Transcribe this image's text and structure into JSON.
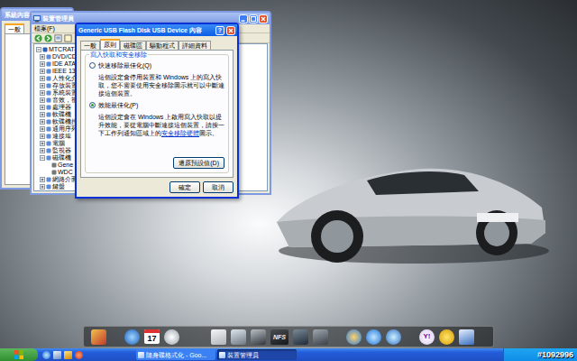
{
  "system_properties": {
    "title": "系統內容",
    "tabs": [
      {
        "label": "一般",
        "selected": true
      }
    ]
  },
  "device_manager": {
    "title": "裝置管理員",
    "menu": [
      "檔案(F)"
    ],
    "tree": [
      {
        "label": "MTCRAT-B8",
        "kind": "root",
        "expanded": true
      },
      {
        "label": "DVD/CD-",
        "kind": "category",
        "expanded": false
      },
      {
        "label": "IDE ATA",
        "kind": "category",
        "expanded": false
      },
      {
        "label": "IEEE 13",
        "kind": "category",
        "expanded": false
      },
      {
        "label": "人性化介",
        "kind": "category",
        "expanded": false
      },
      {
        "label": "存放裝置",
        "kind": "category",
        "expanded": false
      },
      {
        "label": "系統裝置",
        "kind": "category",
        "expanded": false
      },
      {
        "label": "音效，視",
        "kind": "category",
        "expanded": false
      },
      {
        "label": "處理器",
        "kind": "category",
        "expanded": false
      },
      {
        "label": "軟碟機",
        "kind": "category",
        "expanded": false
      },
      {
        "label": "軟碟機控",
        "kind": "category",
        "expanded": false
      },
      {
        "label": "通用序列",
        "kind": "category",
        "expanded": false
      },
      {
        "label": "連接埠",
        "kind": "category",
        "expanded": false
      },
      {
        "label": "電腦",
        "kind": "category",
        "expanded": false
      },
      {
        "label": "監視器",
        "kind": "category",
        "expanded": false
      },
      {
        "label": "磁碟機",
        "kind": "category",
        "expanded": true
      },
      {
        "label": "Gene",
        "kind": "device",
        "expanded": false
      },
      {
        "label": "WDC",
        "kind": "device",
        "expanded": false
      },
      {
        "label": "網路介面",
        "kind": "category",
        "expanded": false
      },
      {
        "label": "鍵盤",
        "kind": "category",
        "expanded": false
      }
    ]
  },
  "dialog": {
    "title": "Generic USB Flash Disk USB Device 內容",
    "help": "?",
    "tabs": [
      {
        "label": "一般",
        "selected": false
      },
      {
        "label": "原則",
        "selected": true
      },
      {
        "label": "磁碟區",
        "selected": false
      },
      {
        "label": "驅動程式",
        "selected": false
      },
      {
        "label": "詳細資料",
        "selected": false
      }
    ],
    "group_title": "寫入快取和安全移除",
    "options": [
      {
        "label": "快速移除最佳化(Q)",
        "description": "這個設定會停用裝置和 Windows 上的寫入快取，您不需要使用安全移除圖示就可以中斷連接這個裝置。",
        "link": "",
        "description_after": "",
        "selected": false
      },
      {
        "label": "效能最佳化(P)",
        "description": "這個設定會在 Windows 上啟用寫入快取以提升效能，要從電腦中斷連接這個裝置，請按一下工作列通知區域上的",
        "link": "安全移除硬體",
        "description_after": "圖示。",
        "selected": true
      }
    ],
    "default_button": "還原預設值(D)",
    "buttons": [
      "確定",
      "取消"
    ]
  },
  "dock": {
    "calendar_day": "17",
    "game_label": "NFS",
    "messenger_label": "Y!"
  },
  "taskbar": {
    "tasks": [
      {
        "label": "隨身碟格式化 - Goo...",
        "selected": false
      },
      {
        "label": "裝置管理員",
        "selected": true
      }
    ],
    "watermark": "#1092996"
  }
}
